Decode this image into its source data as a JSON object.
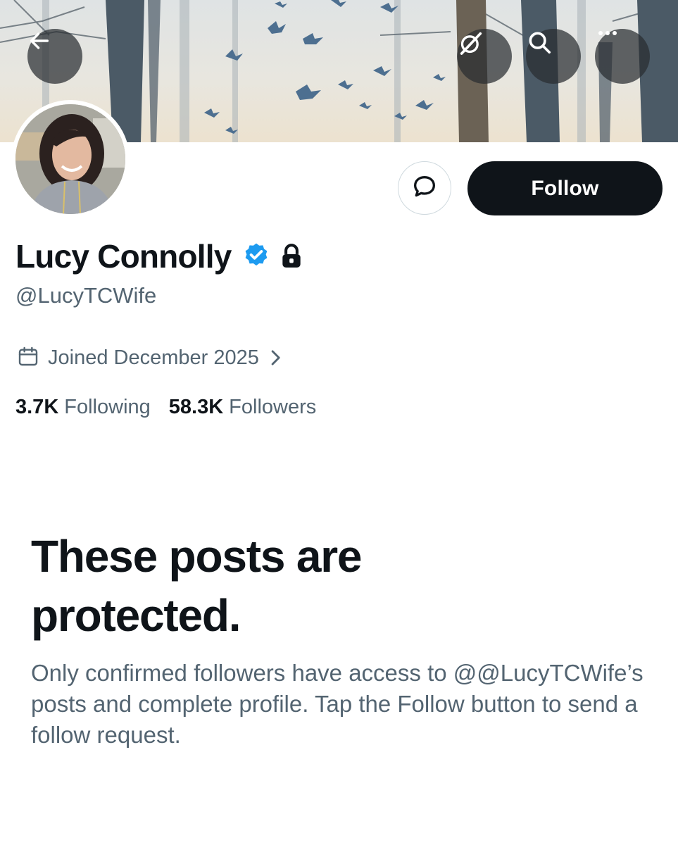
{
  "header": {
    "back_icon": "arrow-left-icon",
    "grok_icon": "grok-icon",
    "search_icon": "search-icon",
    "more_icon": "more-horizontal-icon"
  },
  "profile": {
    "display_name": "Lucy Connolly",
    "handle": "@LucyTCWife",
    "verified": true,
    "protected": true,
    "joined": "Joined December 2025",
    "following_count": "3.7K",
    "following_label": "Following",
    "followers_count": "58.3K",
    "followers_label": "Followers"
  },
  "actions": {
    "message_icon": "message-bubble-icon",
    "follow_label": "Follow"
  },
  "protected_notice": {
    "title": "These posts are protected.",
    "body": "Only confirmed followers have access to @@LucyTCWife’s posts and complete profile. Tap the Follow button to send a follow request."
  },
  "colors": {
    "verified_blue": "#1d9bf0",
    "text_primary": "#0f1419",
    "text_secondary": "#536471",
    "follow_button_bg": "#0f1419"
  }
}
